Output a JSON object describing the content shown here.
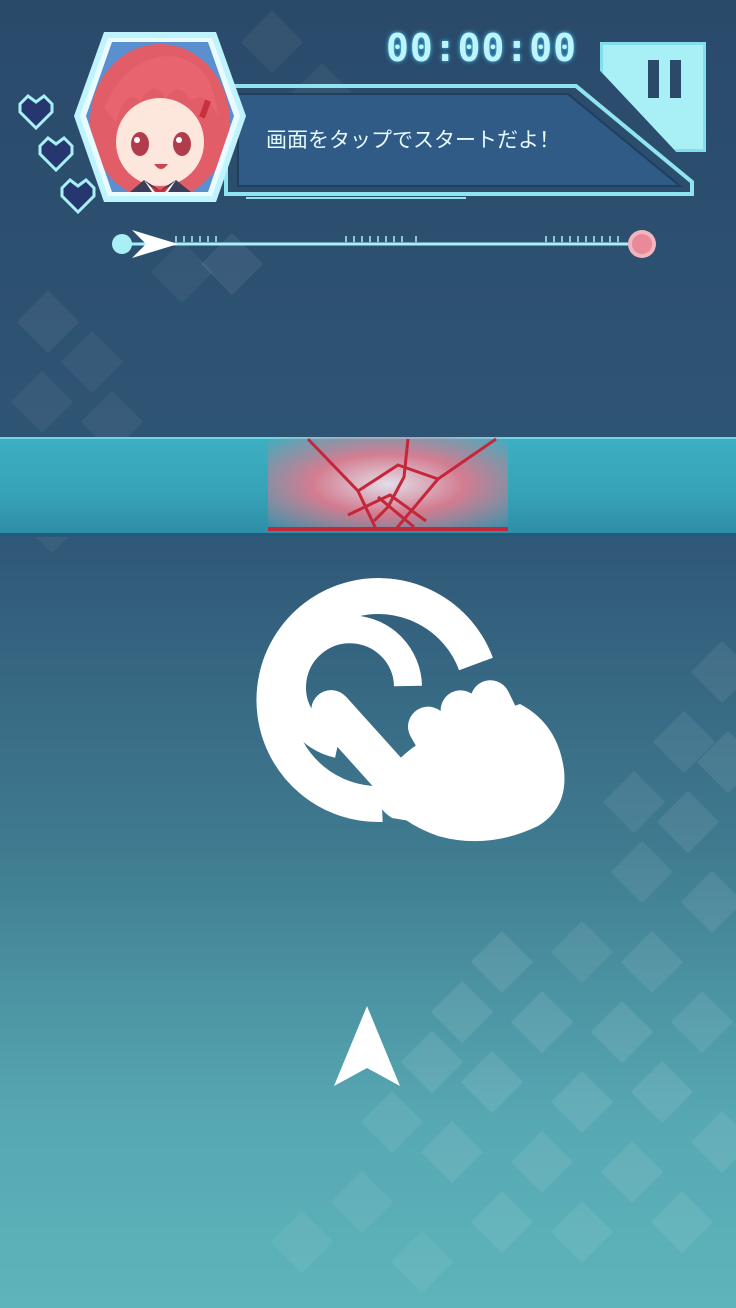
{
  "hud": {
    "timer": "00:00:00",
    "pause_icon": "pause-icon"
  },
  "character": {
    "speech": "画面をタップでスタートだよ！",
    "portrait_icon": "character-portrait",
    "lives": 3,
    "heart_icon": "heart-icon"
  },
  "progress": {
    "value": 0,
    "start_marker": "arrow-marker-icon",
    "goal_marker": "goal-ring-icon"
  },
  "play": {
    "hint_icon": "tap-hand-icon",
    "player_icon": "player-ship-icon"
  },
  "colors": {
    "accent": "#a9eff6",
    "barrier": "#36a2b7",
    "crack": "#e05a6e",
    "goal": "#e88a98"
  }
}
